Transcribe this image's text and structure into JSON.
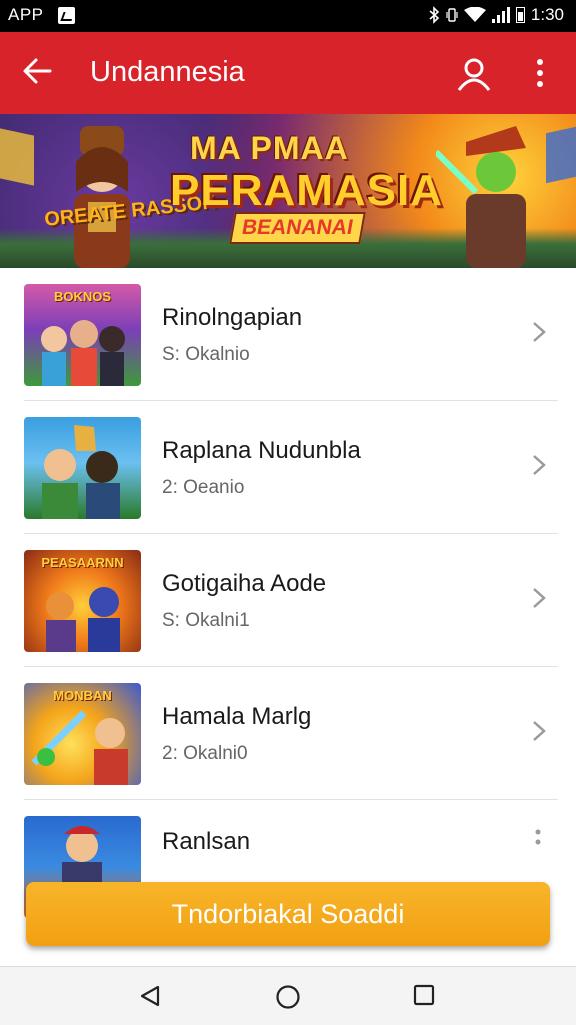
{
  "status_bar": {
    "app_label": "APP",
    "time": "1:30",
    "icons": [
      "notification-icon",
      "bluetooth-icon",
      "vibrate-icon",
      "wifi-icon",
      "signal-icon",
      "battery-icon"
    ]
  },
  "app_bar": {
    "title": "Undannesia",
    "background_color": "#d9232a",
    "icons": {
      "back": "back-arrow-icon",
      "profile": "person-icon",
      "menu": "more-vert-icon"
    }
  },
  "banner": {
    "line1": "MA PMAA",
    "line2": "PERAMASIA",
    "line3": "BEANANAI",
    "logo": "OREATE RASSOK"
  },
  "games": [
    {
      "name": "Rinolngapian",
      "subtitle": "S: Okalnio",
      "thumb_caption": "BOKNOS"
    },
    {
      "name": "Raplana Nudunbla",
      "subtitle": "2: Oeanio",
      "thumb_caption": ""
    },
    {
      "name": "Gotigaiha Aode",
      "subtitle": "S: Okalni1",
      "thumb_caption": "PEASAARNN"
    },
    {
      "name": "Hamala Marlg",
      "subtitle": "2: Okalni0",
      "thumb_caption": "MONBAN"
    },
    {
      "name": "Ranlsan",
      "subtitle": "",
      "thumb_caption": ""
    }
  ],
  "cta": {
    "label": "Tndorbiakal Soaddi",
    "color": "#f4a516"
  },
  "nav_bar": {
    "icons": [
      "nav-back-icon",
      "nav-home-icon",
      "nav-recents-icon"
    ]
  }
}
